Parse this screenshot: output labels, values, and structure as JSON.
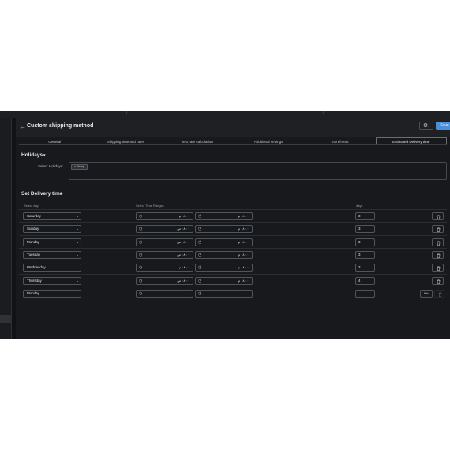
{
  "header": {
    "back_icon": "arrow-left-icon",
    "title": "Custom shipping method",
    "gear_icon": "gear-icon",
    "gear_caret": "▾",
    "save_label": "Save"
  },
  "tabs": [
    {
      "label": "General",
      "active": false
    },
    {
      "label": "Shipping time and rates",
      "active": false
    },
    {
      "label": "Test rate calculation",
      "active": false
    },
    {
      "label": "Additional settings",
      "active": false
    },
    {
      "label": "Storefronts",
      "active": false
    },
    {
      "label": "Estimated Delivery time",
      "active": true
    }
  ],
  "holidays": {
    "title": "Holidays",
    "caret": "▼",
    "label": "Select Holidays:",
    "chips": [
      "× Friday"
    ]
  },
  "delivery": {
    "title": "Set Delivery time",
    "caret": "▼",
    "col_day": "Select day",
    "col_time": "Select Time Ranges",
    "col_days": "days",
    "rows": [
      {
        "day": "Saturday",
        "from": "٠٨:٠٠ م",
        "to": "٠٨:٠٠ م",
        "days": "3",
        "action": "delete"
      },
      {
        "day": "Sunday",
        "from": "٠٨:٠٠ ص",
        "to": "٠٨:٠٠ م",
        "days": "3",
        "action": "delete"
      },
      {
        "day": "Monday",
        "from": "٠٨:٠٠ ص",
        "to": "٠٨:٠٠ م",
        "days": "3",
        "action": "delete"
      },
      {
        "day": "Tuesday",
        "from": "٠٨:٠٠ ص",
        "to": "٠٨:٠٠ م",
        "days": "3",
        "action": "delete"
      },
      {
        "day": "Wednesday",
        "from": "٠٨:٠٠ م",
        "to": "٠٨:٠٠ م",
        "days": "3",
        "action": "delete"
      },
      {
        "day": "Thursday",
        "from": "٠٨:٠٠ ص",
        "to": "٠٨:٠٠ م",
        "days": "4",
        "action": "delete"
      }
    ],
    "new_row": {
      "day": "Monday",
      "from": "-- :-- --",
      "to": "-- :-- --",
      "days": "",
      "add_label": "Add"
    }
  },
  "icons": {
    "clock": "clock-icon",
    "trash": "trash-icon",
    "chevron": "chevron-down-icon"
  },
  "colors": {
    "background": "#17191c",
    "accent": "#4a8fd8",
    "border": "#50555b",
    "text": "#e3e5e8"
  }
}
